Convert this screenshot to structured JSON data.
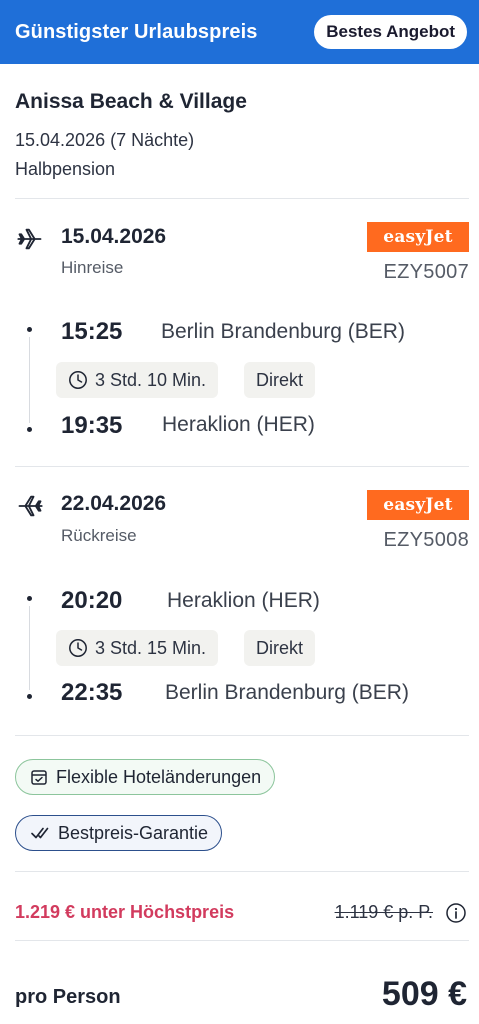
{
  "header": {
    "title": "Günstigster Urlaubspreis",
    "badge": "Bestes Angebot"
  },
  "hotel": {
    "name": "Anissa Beach & Village",
    "dates": "15.04.2026 (7 Nächte)",
    "board": "Halbpension"
  },
  "outbound": {
    "date": "15.04.2026",
    "kind": "Hinreise",
    "airline": "easyJet",
    "flight_number": "EZY5007",
    "departure_time": "15:25",
    "departure_airport": "Berlin Brandenburg (BER)",
    "duration": "3 Std. 10 Min.",
    "stops": "Direkt",
    "arrival_time": "19:35",
    "arrival_airport": "Heraklion (HER)",
    "icon": "plane-departure-icon"
  },
  "return": {
    "date": "22.04.2026",
    "kind": "Rückreise",
    "airline": "easyJet",
    "flight_number": "EZY5008",
    "departure_time": "20:20",
    "departure_airport": "Heraklion (HER)",
    "duration": "3 Std. 15 Min.",
    "stops": "Direkt",
    "arrival_time": "22:35",
    "arrival_airport": "Berlin Brandenburg (BER)",
    "icon": "plane-return-icon"
  },
  "features": {
    "flexible": "Flexible Hoteländerungen",
    "guarantee": "Bestpreis-Garantie"
  },
  "pricing": {
    "savings": "1.219 € unter Höchstpreis",
    "old_price": "1.119 € p. P.",
    "per_person_label": "pro Person",
    "price": "509 €"
  },
  "colors": {
    "header": "#1f6fd8",
    "easyjet": "#ff6a1f",
    "savings": "#d23b5e"
  }
}
